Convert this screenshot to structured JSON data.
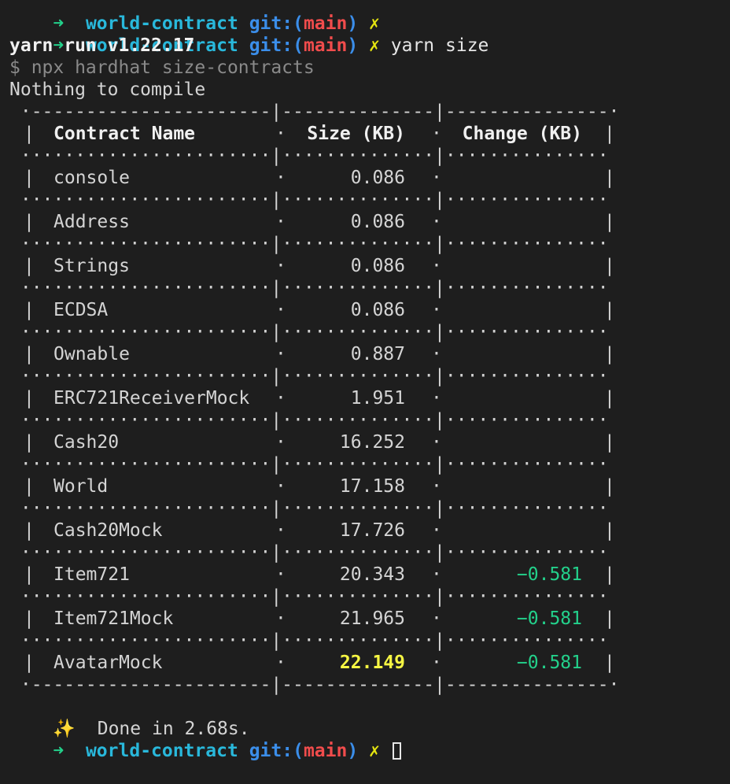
{
  "prompt": {
    "arrow": "➜",
    "dir": "world-contract",
    "git_label": "git:(",
    "branch": "main",
    "git_close": ")",
    "dirty_mark": "✗"
  },
  "lines": {
    "command": "yarn size",
    "yarn_run": "yarn run v1.22.17",
    "npx_cmd": "$ npx hardhat size-contracts",
    "nothing": "Nothing to compile",
    "done_icon": "✨",
    "done": "Done in 2.68s."
  },
  "table": {
    "border_top": " ·----------------------|--------------|---------------·",
    "border_row": " ·······················|··············|···············",
    "border_bottom": " ·----------------------|--------------|---------------·",
    "headers": {
      "name": "Contract Name",
      "size": "Size (KB)",
      "change": "Change (KB)"
    },
    "rows": [
      {
        "name": "console",
        "size": "0.086",
        "change": ""
      },
      {
        "name": "Address",
        "size": "0.086",
        "change": ""
      },
      {
        "name": "Strings",
        "size": "0.086",
        "change": ""
      },
      {
        "name": "ECDSA",
        "size": "0.086",
        "change": ""
      },
      {
        "name": "Ownable",
        "size": "0.887",
        "change": ""
      },
      {
        "name": "ERC721ReceiverMock",
        "size": "1.951",
        "change": ""
      },
      {
        "name": "Cash20",
        "size": "16.252",
        "change": ""
      },
      {
        "name": "World",
        "size": "17.158",
        "change": ""
      },
      {
        "name": "Cash20Mock",
        "size": "17.726",
        "change": ""
      },
      {
        "name": "Item721",
        "size": "20.343",
        "change": "−0.581"
      },
      {
        "name": "Item721Mock",
        "size": "21.965",
        "change": "−0.581"
      },
      {
        "name": "AvatarMock",
        "size": "22.149",
        "change": "−0.581"
      }
    ]
  },
  "colors": {
    "background": "#1e1e1e",
    "arrow": "#23d18b",
    "dir": "#29b8db",
    "branch": "#f14c4c",
    "change_negative": "#23d18b",
    "highlight_size": "#f5f543"
  }
}
